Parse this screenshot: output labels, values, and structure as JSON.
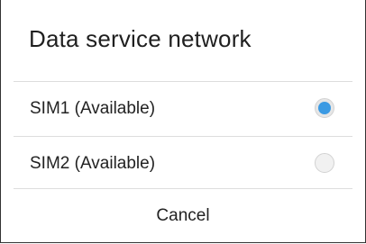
{
  "dialog": {
    "title": "Data service network",
    "options": [
      {
        "label": "SIM1 (Available)",
        "selected": true
      },
      {
        "label": "SIM2 (Available)",
        "selected": false
      }
    ],
    "cancel_label": "Cancel",
    "accent_color": "#3b9ae3"
  }
}
